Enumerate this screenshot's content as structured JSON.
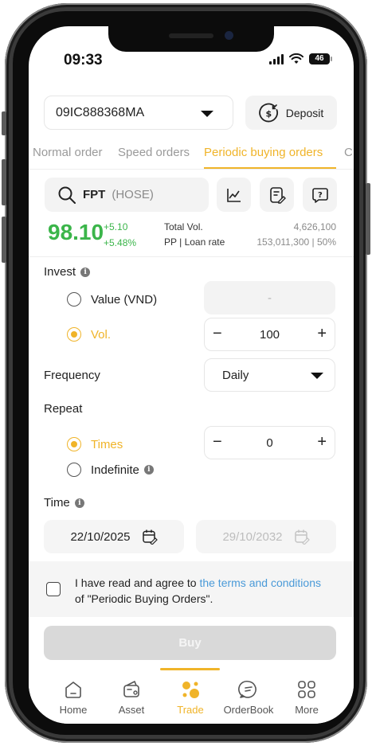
{
  "status": {
    "time": "09:33",
    "battery": "46"
  },
  "account": {
    "id": "09IC888368MA",
    "deposit_label": "Deposit"
  },
  "tabs": [
    {
      "label": "Normal order"
    },
    {
      "label": "Speed orders"
    },
    {
      "label": "Periodic buying orders"
    },
    {
      "label": "C"
    }
  ],
  "search": {
    "symbol": "FPT",
    "exchange": "(HOSE)"
  },
  "quote": {
    "price": "98.10",
    "change": "+5.10",
    "change_pct": "+5.48%",
    "total_vol_label": "Total Vol.",
    "total_vol": "4,626,100",
    "pp_label": "PP | Loan rate",
    "pp_value": "153,011,300 | 50%"
  },
  "invest": {
    "label": "Invest",
    "value_option": "Value (VND)",
    "value_placeholder": "-",
    "vol_option": "Vol.",
    "vol_value": "100"
  },
  "frequency": {
    "label": "Frequency",
    "value": "Daily"
  },
  "repeat": {
    "label": "Repeat",
    "times_option": "Times",
    "times_value": "0",
    "indefinite_option": "Indefinite"
  },
  "time": {
    "label": "Time",
    "start_date": "22/10/2025",
    "end_date": "29/10/2032"
  },
  "agreement": {
    "prefix": "I have read and agree to ",
    "link": "the terms and conditions",
    "suffix": "of \"Periodic Buying Orders\"."
  },
  "buy_label": "Buy",
  "nav": [
    {
      "label": "Home"
    },
    {
      "label": "Asset"
    },
    {
      "label": "Trade"
    },
    {
      "label": "OrderBook"
    },
    {
      "label": "More"
    }
  ],
  "colors": {
    "accent": "#f0b429",
    "up": "#3bb54a",
    "link": "#4a9ad8"
  }
}
